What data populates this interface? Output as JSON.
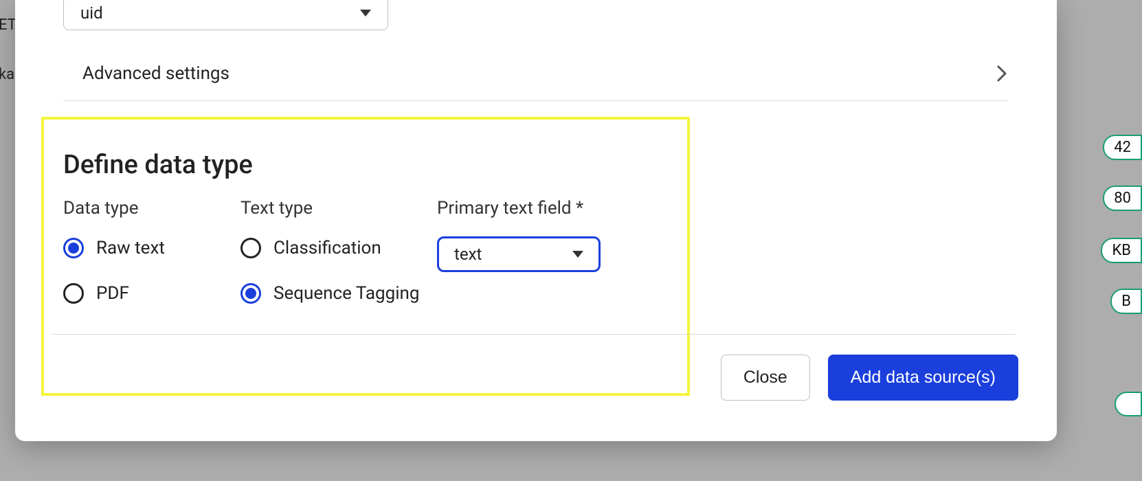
{
  "uid_select": {
    "value": "uid"
  },
  "advanced": {
    "label": "Advanced settings"
  },
  "section": {
    "title": "Define data type",
    "data_type": {
      "label": "Data type",
      "options": [
        {
          "label": "Raw text",
          "selected": true
        },
        {
          "label": "PDF",
          "selected": false
        }
      ]
    },
    "text_type": {
      "label": "Text type",
      "options": [
        {
          "label": "Classification",
          "selected": false
        },
        {
          "label": "Sequence Tagging",
          "selected": true
        }
      ]
    },
    "primary_field": {
      "label": "Primary text field *",
      "value": "text"
    }
  },
  "footer": {
    "close": "Close",
    "add": "Add data source(s)"
  },
  "background": {
    "frag1": "ET",
    "frag2": "ka",
    "badge1": "42",
    "badge2": "80",
    "badge3": "KB",
    "badge4": "B"
  }
}
